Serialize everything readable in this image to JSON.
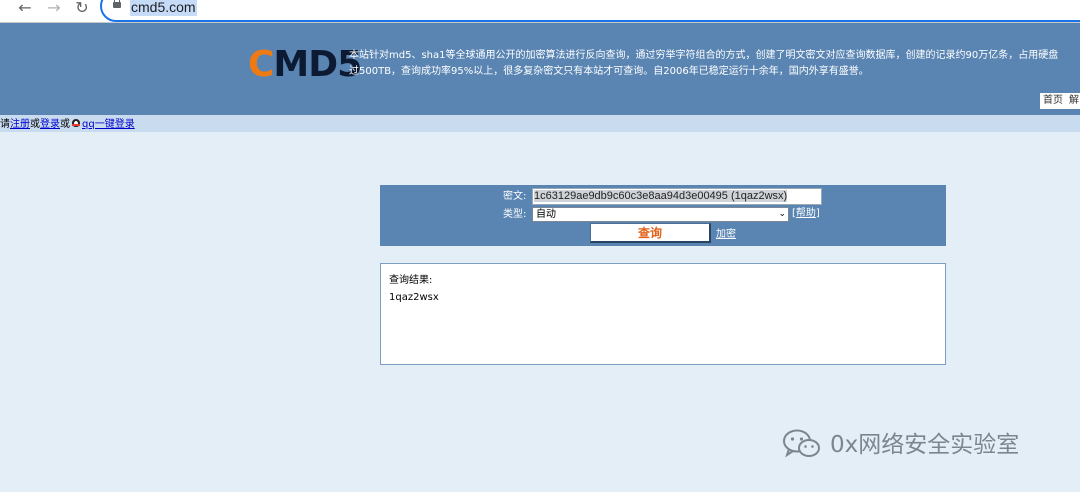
{
  "browser": {
    "url": "cmd5.com"
  },
  "header": {
    "logo_first": "C",
    "logo_rest": "MD5",
    "intro_line1": "本站针对md5、sha1等全球通用公开的加密算法进行反向查询，通过穷举字符组合的方式，创建了明文密文对应查询数据库，创建的记录约90万亿条，占用硬盘",
    "intro_line2": "过500TB，查询成功率95%以上，很多复杂密文只有本站才可查询。自2006年已稳定运行十余年，国内外享有盛誉。",
    "nav_home": "首页",
    "nav_next": "解"
  },
  "login_bar": {
    "prefix": "请",
    "register": "注册",
    "or1": "或",
    "login": "登录",
    "or2": "或",
    "qq_login": "qq一键登录"
  },
  "query": {
    "cipher_label": "密文:",
    "cipher_value": "1c63129ae9db9c60c3e8aa94d3e00495 (1qaz2wsx)",
    "type_label": "类型:",
    "type_value": "自动",
    "help_open": "[",
    "help_text": "帮助",
    "help_close": "]",
    "submit_label": "查询",
    "encrypt_link": "加密"
  },
  "result": {
    "label": "查询结果:",
    "value": "1qaz2wsx"
  },
  "watermark": {
    "text": "0x网络安全实验室"
  },
  "colors": {
    "header_bg": "#5a85b2",
    "page_bg": "#e4eef7",
    "logo_orange": "#f07a12",
    "button_text": "#e2621a"
  }
}
